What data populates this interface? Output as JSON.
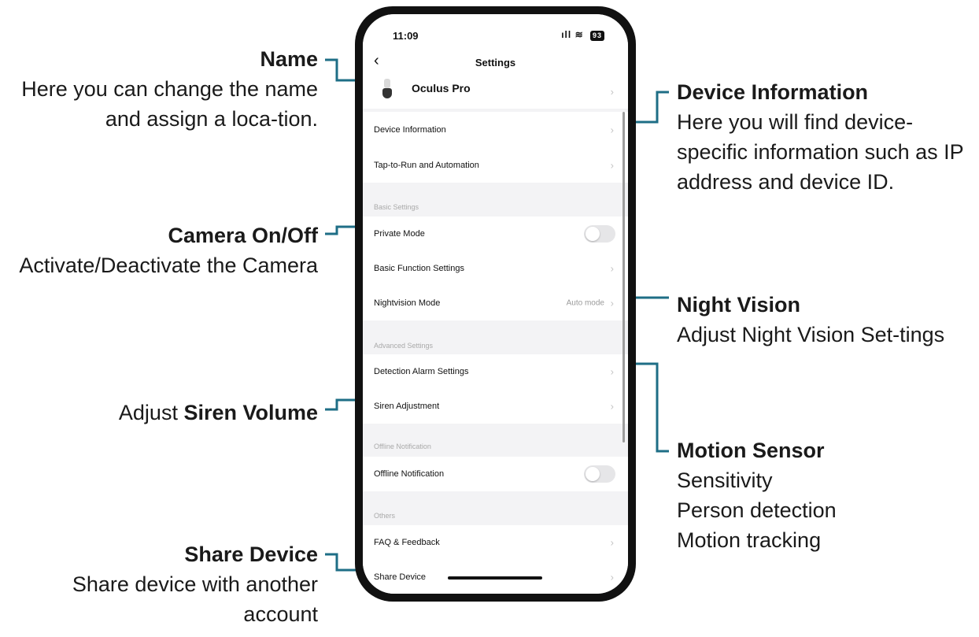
{
  "callouts": {
    "name": {
      "title": "Name",
      "desc": "Here you can change the name and assign a loca-tion."
    },
    "camera": {
      "title": "Camera On/Off",
      "desc": "Activate/Deactivate the Camera"
    },
    "siren": {
      "prefix": "Adjust ",
      "title": "Siren Volume"
    },
    "share": {
      "title": "Share Device",
      "desc": "Share device with another account"
    },
    "device_info": {
      "title": "Device Information",
      "desc": "Here you will find device-specific information such as IP address and device ID."
    },
    "night": {
      "title": "Night Vision",
      "desc": "Adjust Night Vision Set-tings"
    },
    "motion": {
      "title": "Motion Sensor",
      "lines": [
        "Sensitivity",
        "Person detection",
        "Motion tracking"
      ]
    }
  },
  "status_bar": {
    "time": "11:09",
    "signal": "ıll",
    "wifi": "≋",
    "battery": "93"
  },
  "nav": {
    "back": "‹",
    "title": "Settings"
  },
  "device": {
    "name": "Oculus Pro"
  },
  "rows": {
    "device_information": "Device Information",
    "tap_to_run": "Tap-to-Run and Automation",
    "private_mode": "Private Mode",
    "basic_function": "Basic Function Settings",
    "nightvision": "Nightvision Mode",
    "nightvision_value": "Auto mode",
    "detection_alarm": "Detection Alarm Settings",
    "siren_adjustment": "Siren Adjustment",
    "offline_notification": "Offline Notification",
    "faq": "FAQ & Feedback",
    "share_device": "Share Device"
  },
  "sections": {
    "basic": "Basic Settings",
    "advanced": "Advanced Settings",
    "offline": "Offline Notification",
    "others": "Others"
  },
  "toggles": {
    "private_mode": "off",
    "offline_notification": "off"
  },
  "chevron": "›",
  "colors": {
    "accent_line": "#1e6e86",
    "toggle_off": "#e6e6e8"
  }
}
